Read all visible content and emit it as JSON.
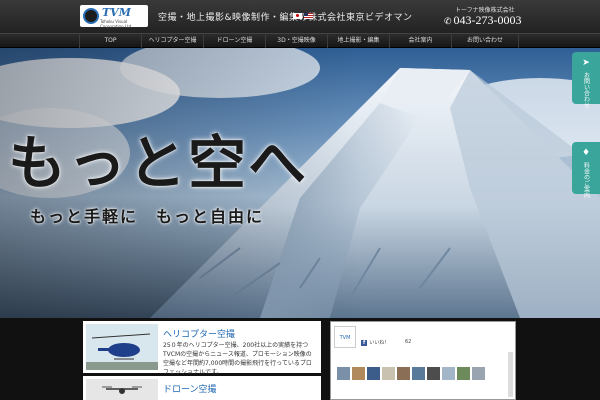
{
  "header": {
    "logo_text": "TVM",
    "logo_sub": "Tohoku Visual Corporation Ltd.",
    "tagline": "空撮・地上撮影&映像制作・編集の株式会社東京ビデオマン",
    "company": "トーフナ映像株式会社",
    "phone": "043-273-0003"
  },
  "nav": [
    {
      "label": "TOP"
    },
    {
      "label": "ヘリコプター空撮"
    },
    {
      "label": "ドローン空撮"
    },
    {
      "label": "3D・空撮映像"
    },
    {
      "label": "地上撮影・編集"
    },
    {
      "label": "会社案内"
    },
    {
      "label": "お問い合わせ"
    }
  ],
  "hero": {
    "headline": "もっと空へ",
    "subhead": "もっと手軽に　もっと自由に",
    "side_tabs": [
      {
        "icon": "send-icon",
        "label": "お問い合わせ"
      },
      {
        "icon": "tag-icon",
        "label": "料金のご案内"
      }
    ]
  },
  "cards": [
    {
      "title": "ヘリコプター空撮",
      "body": "25０年のヘリコプター空撮、200社以上の実績を持つTVCMの空撮からニュース報道、プロモーション映像の空撮など年間約7,000時間の撮影飛行を行っているプロフェッショナルです。"
    },
    {
      "title": "ドローン空撮",
      "body": ""
    }
  ],
  "facebook": {
    "logo_text": "TVM",
    "like_label": "いいね！",
    "count": "62"
  },
  "colors": {
    "accent_teal": "#3aa59a",
    "link_blue": "#1e66b0",
    "brand_blue": "#2a6db3"
  }
}
